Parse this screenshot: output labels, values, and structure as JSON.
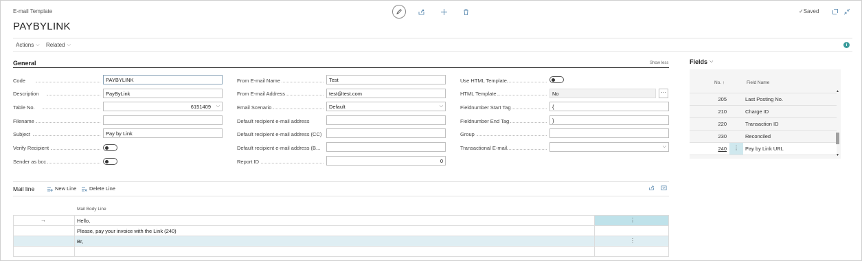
{
  "header": {
    "page_type": "E-mail Template",
    "title": "PAYBYLINK",
    "saved_label": "Saved",
    "check_glyph": "✓"
  },
  "menu": {
    "actions": "Actions",
    "related": "Related",
    "chevron": "⌵",
    "info_glyph": "i"
  },
  "general": {
    "title": "General",
    "show_less": "Show less",
    "col1": [
      {
        "label": "Code",
        "value": "PAYBYLINK",
        "type": "text"
      },
      {
        "label": "Description",
        "value": "PayByLink",
        "type": "text"
      },
      {
        "label": "Table No.",
        "value": "6151409",
        "type": "select-right"
      },
      {
        "label": "Filename",
        "value": "",
        "type": "text"
      },
      {
        "label": "Subject",
        "value": "Pay by Link",
        "type": "text"
      },
      {
        "label": "Verify Recipient",
        "value": "off",
        "type": "toggle"
      },
      {
        "label": "Sender as bcc",
        "value": "off",
        "type": "toggle"
      }
    ],
    "col2": [
      {
        "label": "From E-mail Name",
        "value": "Test",
        "type": "text"
      },
      {
        "label": "From E-mail Address",
        "value": "test@test.com",
        "type": "text"
      },
      {
        "label": "Email Scenario",
        "value": "Default",
        "type": "select"
      },
      {
        "label": "Default recipient e-mail address",
        "value": "",
        "type": "text"
      },
      {
        "label": "Default recipient e-mail address (CC)",
        "value": "",
        "type": "text"
      },
      {
        "label": "Default recipient e-mail address (B...",
        "value": "",
        "type": "text"
      },
      {
        "label": "Report ID",
        "value": "0",
        "type": "number"
      }
    ],
    "col3": [
      {
        "label": "Use HTML Template",
        "value": "off",
        "type": "toggle"
      },
      {
        "label": "HTML Template",
        "value": "No",
        "type": "lookup"
      },
      {
        "label": "Fieldnumber Start Tag",
        "value": "{",
        "type": "text"
      },
      {
        "label": "Fieldnumber End Tag",
        "value": "}",
        "type": "text"
      },
      {
        "label": "Group",
        "value": "",
        "type": "text"
      },
      {
        "label": "Transactional E-mail",
        "value": "",
        "type": "select"
      }
    ],
    "ellipsis": "···",
    "chevron": "⌵"
  },
  "mail_line": {
    "title": "Mail line",
    "new_line": "New Line",
    "delete_line": "Delete Line",
    "column_header": "Mail Body Line",
    "arrow": "→",
    "kebab": "⋮",
    "rows": [
      {
        "text": "Hello,",
        "current": true,
        "selected": false
      },
      {
        "text": "Please, pay your invoice with the Link (240)",
        "current": false,
        "selected": false
      },
      {
        "text": "Br,",
        "current": false,
        "selected": true
      },
      {
        "text": "",
        "current": false,
        "selected": false
      }
    ]
  },
  "fields": {
    "title": "Fields",
    "col_no": "No. ↑",
    "col_name": "Field Name",
    "kebab": "⋮",
    "rows": [
      {
        "no": "205",
        "name": "Last Posting No."
      },
      {
        "no": "210",
        "name": "Charge ID"
      },
      {
        "no": "220",
        "name": "Transaction ID"
      },
      {
        "no": "230",
        "name": "Reconciled"
      },
      {
        "no": "240",
        "name": "Pay by Link URL"
      }
    ]
  }
}
